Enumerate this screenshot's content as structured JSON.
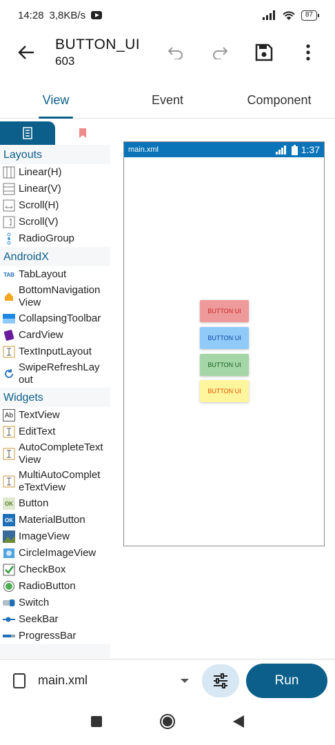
{
  "status": {
    "time": "14:28",
    "speed": "3,8KB/s",
    "battery": "87"
  },
  "app_bar": {
    "title": "BUTTON_UI",
    "subtitle": "603"
  },
  "tabs": [
    {
      "label": "View"
    },
    {
      "label": "Event"
    },
    {
      "label": "Component"
    }
  ],
  "palette": {
    "sections": [
      {
        "title": "Layouts",
        "items": [
          "Linear(H)",
          "Linear(V)",
          "Scroll(H)",
          "Scroll(V)",
          "RadioGroup"
        ]
      },
      {
        "title": "AndroidX",
        "items": [
          "TabLayout",
          "BottomNavigation View",
          "CollapsingToolbar",
          "CardView",
          "TextInputLayout",
          "SwipeRefreshLay out"
        ]
      },
      {
        "title": "Widgets",
        "items": [
          "TextView",
          "EditText",
          "AutoCompleteText View",
          "MultiAutoComplet eTextView",
          "Button",
          "MaterialButton",
          "ImageView",
          "CircleImageView",
          "CheckBox",
          "RadioButton",
          "Switch",
          "SeekBar",
          "ProgressBar"
        ]
      }
    ]
  },
  "preview": {
    "file": "main.xml",
    "time": "1:37",
    "buttons": [
      {
        "label": "BUTTON UI",
        "color": "#ef9a9a",
        "text_color": "#c62828"
      },
      {
        "label": "BUTTON UI",
        "color": "#90caf9",
        "text_color": "#0d47a1"
      },
      {
        "label": "BUTTON UI",
        "color": "#a5d6a7",
        "text_color": "#1b5e20"
      },
      {
        "label": "BUTTON UI",
        "color": "#fff59d",
        "text_color": "#e65100"
      }
    ]
  },
  "bottom": {
    "file_name": "main.xml",
    "run_label": "Run"
  },
  "colors": {
    "accent": "#0b5f8a",
    "preview_bar": "#0b74b8"
  }
}
